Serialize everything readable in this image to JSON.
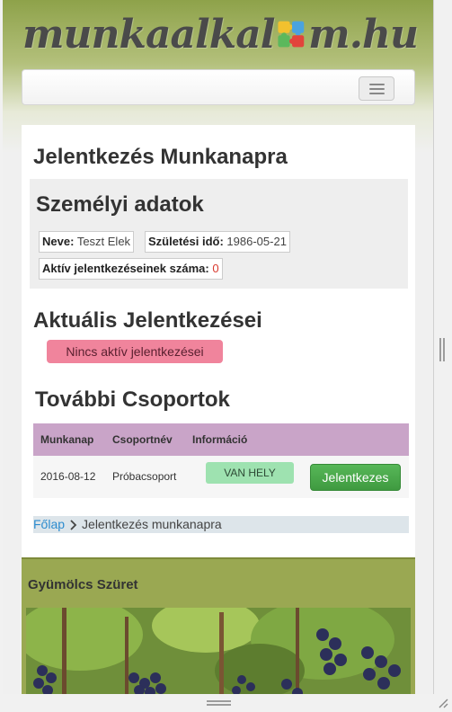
{
  "logo": {
    "part1": "munkaalkal",
    "part2": "m.hu"
  },
  "page_title": "Jelentkezés Munkanapra",
  "personal": {
    "heading": "Személyi adatok",
    "name_label": "Neve:",
    "name_value": "Teszt Elek",
    "birth_label": "Születési idő:",
    "birth_value": "1986-05-21",
    "active_label": "Aktív jelentkezéseinek száma:",
    "active_value": "0"
  },
  "current": {
    "heading": "Aktuális Jelentkezései",
    "none_badge": "Nincs aktív jelentkezései"
  },
  "groups": {
    "heading": "További Csoportok",
    "columns": [
      "Munkanap",
      "Csoportnév",
      "Információ"
    ],
    "rows": [
      {
        "date": "2016-08-12",
        "group": "Próbacsoport",
        "status": "VAN HELY",
        "action": "Jelentkezes"
      }
    ]
  },
  "breadcrumb": {
    "home": "Főlap",
    "current": "Jelentkezés munkanapra"
  },
  "gallery": {
    "title": "Gyümölcs Szüret"
  },
  "colors": {
    "header_green": "#8ea24a",
    "table_header": "#c9a4c8",
    "status_green": "#9ee2b0",
    "button_green": "#4cae4c",
    "badge_pink": "#f0849c",
    "link_blue": "#2d8ccf"
  }
}
